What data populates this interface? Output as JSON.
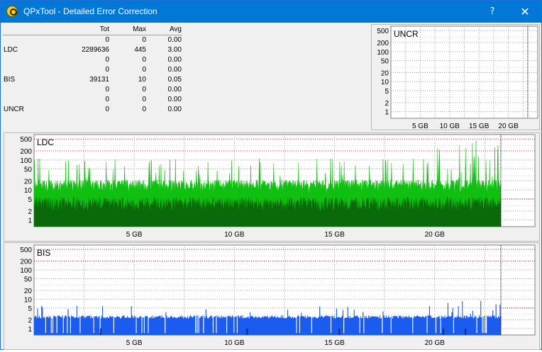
{
  "window": {
    "title": "QPxTool - Detailed Error Correction",
    "help_label": "?",
    "close_label": "✕"
  },
  "stats": {
    "headers": [
      "",
      "Tot",
      "Max",
      "Avg"
    ],
    "rows": [
      [
        "",
        "0",
        "0",
        "0.00"
      ],
      [
        "LDC",
        "2289636",
        "445",
        "3.00"
      ],
      [
        "",
        "0",
        "0",
        "0.00"
      ],
      [
        "",
        "0",
        "0",
        "0.00"
      ],
      [
        "BIS",
        "39131",
        "10",
        "0.05"
      ],
      [
        "",
        "0",
        "0",
        "0.00"
      ],
      [
        "",
        "0",
        "0",
        "0.00"
      ],
      [
        "UNCR",
        "0",
        "0",
        "0.00"
      ]
    ]
  },
  "colors": {
    "ldc_light": "#10c010",
    "ldc_dark": "#0a6a0a",
    "bis": "#1a5cf0",
    "bis_dark": "#0a2a8a",
    "threshold": "#d02020",
    "grid": "#a0a0a0",
    "plot_bg": "#ffffff"
  },
  "charts": [
    {
      "id": "uncr",
      "label": "UNCR",
      "y_ticks": [
        "500",
        "200",
        "100",
        "50",
        "20",
        "10",
        "5",
        "2",
        "1"
      ],
      "x_ticks": [
        "5 GB",
        "10 GB",
        "15 GB",
        "20 GB"
      ],
      "y_scale": "log",
      "x_range_gb": [
        0,
        25
      ],
      "disc_end_gb": 23.3,
      "max_value": 0
    },
    {
      "id": "ldc",
      "label": "LDC",
      "y_ticks": [
        "500",
        "200",
        "100",
        "50",
        "20",
        "10",
        "5",
        "2",
        "1"
      ],
      "x_ticks": [
        "5 GB",
        "10 GB",
        "15 GB",
        "20 GB"
      ],
      "y_scale": "log",
      "x_range_gb": [
        0,
        25
      ],
      "disc_end_gb": 23.3,
      "max_value": 445
    },
    {
      "id": "bis",
      "label": "BIS",
      "y_ticks": [
        "500",
        "200",
        "100",
        "50",
        "20",
        "10",
        "5",
        "2",
        "1"
      ],
      "x_ticks": [
        "5 GB",
        "10 GB",
        "15 GB",
        "20 GB"
      ],
      "y_scale": "log",
      "x_range_gb": [
        0,
        25
      ],
      "disc_end_gb": 23.3,
      "max_value": 10
    }
  ]
}
